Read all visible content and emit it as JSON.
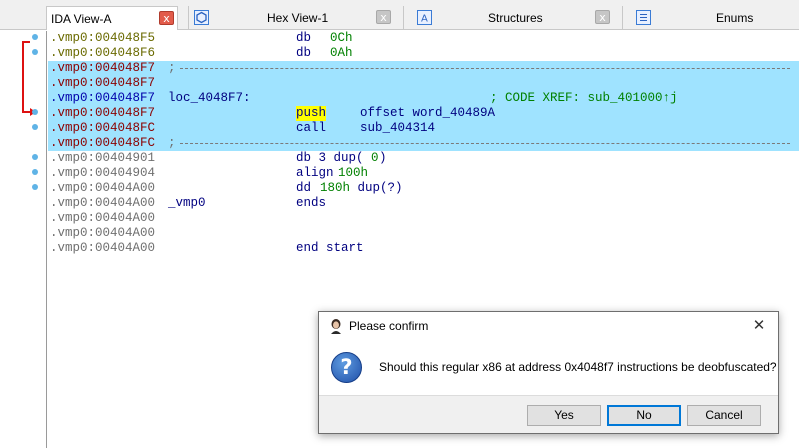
{
  "tabs": [
    {
      "label": "IDA View-A",
      "icon": "ida-view-icon",
      "close": "x"
    },
    {
      "label": "Hex View-1",
      "icon": "hex-view-icon",
      "close": "x"
    },
    {
      "label": "Structures",
      "icon": "structures-icon",
      "close": "x"
    },
    {
      "label": "Enums",
      "icon": "enums-icon"
    }
  ],
  "listing": {
    "lines": [
      {
        "addr": ".vmp0:004048F5",
        "c1": "",
        "mnem": "db",
        "op": "0Ch"
      },
      {
        "addr": ".vmp0:004048F6",
        "c1": "",
        "mnem": "db",
        "op": "0Ah"
      },
      {
        "addr": ".vmp0:004048F7",
        "c1": ";",
        "mnem": "",
        "op": ""
      },
      {
        "addr": ".vmp0:004048F7",
        "c1": "",
        "mnem": "",
        "op": ""
      },
      {
        "addr": ".vmp0:004048F7",
        "c1": "loc_4048F7:",
        "mnem": "",
        "op": "",
        "comment": "; CODE XREF: sub_401000↑j"
      },
      {
        "addr": ".vmp0:004048F7",
        "c1": "",
        "mnem": "push",
        "op": "offset word_40489A"
      },
      {
        "addr": ".vmp0:004048FC",
        "c1": "",
        "mnem": "call",
        "op": "sub_404314"
      },
      {
        "addr": ".vmp0:004048FC",
        "c1": ";",
        "mnem": "",
        "op": ""
      },
      {
        "addr": ".vmp0:00404901",
        "c1": "",
        "mnem": "db 3 dup(",
        "op": "0",
        "tail": ")"
      },
      {
        "addr": ".vmp0:00404904",
        "c1": "",
        "mnem": "align",
        "op": "100h"
      },
      {
        "addr": ".vmp0:00404A00",
        "c1": "",
        "mnem": "dd",
        "op": "180h",
        "tail": " dup(?)"
      },
      {
        "addr": ".vmp0:00404A00",
        "c1": "_vmp0",
        "mnem": "ends",
        "op": ""
      },
      {
        "addr": ".vmp0:00404A00",
        "c1": "",
        "mnem": "",
        "op": ""
      },
      {
        "addr": ".vmp0:00404A00",
        "c1": "",
        "mnem": "",
        "op": ""
      },
      {
        "addr": ".vmp0:00404A00",
        "c1": "",
        "mnem": "end start",
        "op": ""
      }
    ]
  },
  "dialog": {
    "title": "Please confirm",
    "close": "✕",
    "message": "Should this regular x86 at address 0x4048f7 instructions be deobfuscated?",
    "icon": "question-icon",
    "buttons": {
      "yes": "Yes",
      "no": "No",
      "cancel": "Cancel"
    }
  },
  "colors": {
    "highlight": "#9fe3ff",
    "push_highlight": "#ffff00",
    "arrow": "#dd1111",
    "breakpoint": "#5fb3e6"
  }
}
